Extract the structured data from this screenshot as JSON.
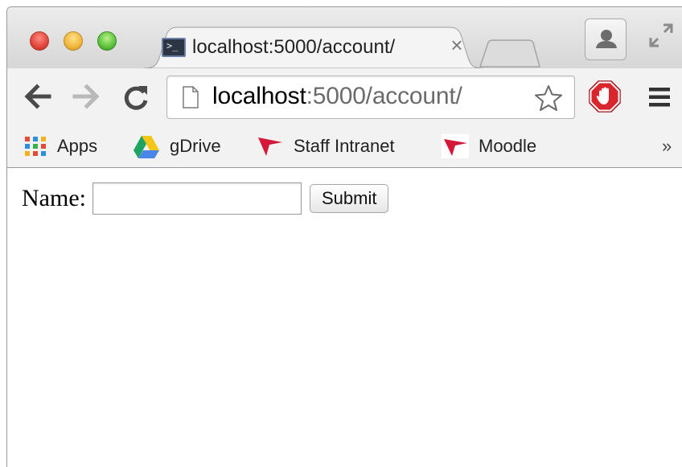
{
  "browser": {
    "tab": {
      "title": "localhost:5000/account/",
      "favicon_glyph": ">_",
      "close_glyph": "×"
    },
    "toolbar": {
      "url_host": "localhost",
      "url_rest": ":5000/account/"
    },
    "bookmarks": [
      {
        "label": "Apps",
        "icon": "apps-grid-icon"
      },
      {
        "label": "gDrive",
        "icon": "google-drive-icon"
      },
      {
        "label": "Staff Intranet",
        "icon": "red-flag-icon"
      },
      {
        "label": "Moodle",
        "icon": "moodle-flag-icon"
      }
    ],
    "bookmarks_overflow": "»",
    "colors": {
      "adblock_red": "#d9262c",
      "bookmark_flag_red": "#d4183a"
    }
  },
  "page": {
    "form": {
      "name_label": "Name:",
      "name_value": "",
      "submit_label": "Submit"
    }
  }
}
